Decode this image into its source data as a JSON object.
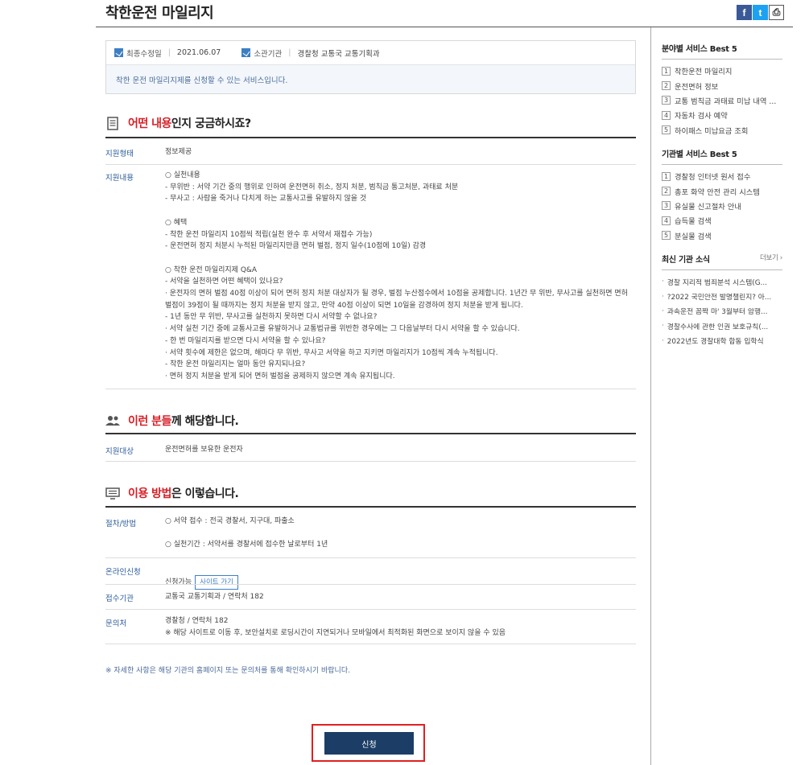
{
  "page": {
    "title": "착한운전 마일리지",
    "share": {
      "facebook": "f",
      "twitter": "t",
      "print": "⎙"
    }
  },
  "info": {
    "updated_label": "최종수정일",
    "updated_value": "2021.06.07",
    "agency_label": "소관기관",
    "agency_value": "경찰청 교통국 교통기획과",
    "description": "착한 운전 마일리지제를 신청할 수 있는 서비스입니다."
  },
  "section_what": {
    "highlight": "어떤 내용",
    "rest": "인지 궁금하시죠?",
    "rows": [
      {
        "label": "지원형태",
        "value": "정보제공"
      },
      {
        "label": "지원내용",
        "value": "○ 실천내용\n - 무위반 : 서약 기간 중의 행위로 인하여 운전면허 취소, 정지 처분, 범칙금 통고처분, 과태료 처분\n - 무사고 : 사람을 죽거나 다치게 하는 교통사고를 유발하지 않을 것\n\n○ 혜택\n - 착한 운전 마일리지 10점씩 적립(실천 완수 후 서약서 재접수 가능)\n - 운전면허 정지 처분시 누적된 마일리지만큼 면허 벌점, 정지 일수(10점에 10일) 감경\n\n○ 착한 운전 마일리지제 Q&A\n - 서약을 실천하면 어떤 혜택이 있나요?\n · 운전자의 면허 벌점 40점 이상이 되어 면허 정지 처분 대상자가 될 경우, 벌점 누산점수에서 10점을 공제합니다. 1년간 무 위반, 무사고를 실천하면 면허 벌점이 39점이 될 때까지는 정지 처분을 받지 않고, 만약 40점 이상이 되면 10일을 감경하여 정지 처분을 받게 됩니다.\n - 1년 동안 무 위반, 무사고를 실천하지 못하면 다시 서약할 수 없나요?\n · 서약 실천 기간 중에 교통사고를 유발하거나 교통법규를 위반한 경우에는 그 다음날부터 다시 서약을 할 수 있습니다.\n - 한 번 마일리지를 받으면 다시 서약을 할 수 있나요?\n · 서약 횟수에 제한은 없으며, 해마다 무 위반, 무사고 서약을 하고 지키면 마일리지가 10점씩 계속 누적됩니다.\n - 착한 운전 마일리지는 얼마 동안 유지되나요?\n · 면허 정지 처분을 받게 되어 면허 벌점을 공제하지 않으면 계속 유지됩니다."
      }
    ]
  },
  "section_who": {
    "highlight": "이런 분들",
    "rest": "께 해당합니다.",
    "rows": [
      {
        "label": "지원대상",
        "value": "운전면허를 보유한 운전자"
      }
    ]
  },
  "section_how": {
    "highlight": "이용 방법",
    "rest": "은 이렇습니다.",
    "rows": [
      {
        "label": "절차/방법",
        "value": "○ 서약 접수 : 전국 경찰서, 지구대, 파출소\n\n○ 실천기간 : 서약서를 경찰서에 접수한 날로부터 1년"
      },
      {
        "label": "온라인신청",
        "value": "신청가능",
        "button": "사이트 가기"
      },
      {
        "label": "접수기관",
        "value": "교통국 교통기획과 / 연락처 182"
      },
      {
        "label": "문의처",
        "value": "경찰청 / 연락처 182\n※ 해당 사이트로 이동 후, 보안설치로 로딩시간이 지연되거나 모바일에서 최적화된 화면으로 보이지 않을 수 있음"
      }
    ]
  },
  "notice": "※ 자세한 사항은 해당 기관의 홈페이지 또는 문의처를 통해 확인하시기 바랍니다.",
  "apply_label": "신청",
  "sidebar": {
    "best_field": {
      "title": "분야별 서비스 Best 5",
      "items": [
        "착한운전 마일리지",
        "운전면허 정보",
        "교통 범칙금 과태료 미납 내역 ...",
        "자동차 검사 예약",
        "하이패스 미납요금 조회"
      ]
    },
    "best_agency": {
      "title": "기관별 서비스 Best 5",
      "items": [
        "경찰청 인터넷 원서 접수",
        "총포 화약 안전 관리 시스템",
        "유실물 신고절차 안내",
        "습득물 검색",
        "분실물 검색"
      ]
    },
    "news": {
      "title": "최신 기관 소식",
      "more": "더보기 ›",
      "items": [
        "경찰 지리적 범죄분석 시스템(G...",
        "?2022 국민안전 발명챌린지? 아...",
        "과속운전 꼼짝 마' 3월부터 암행...",
        "경찰수사에 관한 인권 보호규칙(...",
        "2022년도 경찰대학 합동 입학식"
      ]
    }
  }
}
